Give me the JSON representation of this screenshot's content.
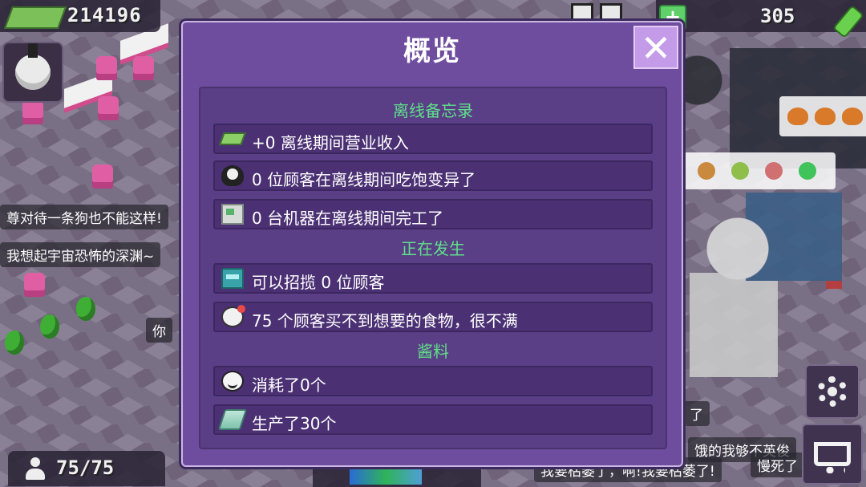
{
  "hud": {
    "money": "214196",
    "customers": "75/75",
    "energy": "305"
  },
  "background_chat": [
    "尊对待一条狗也不能这样!",
    "我想起宇宙恐怖的深渊~",
    "你",
    "饿的我够不英俊",
    "慢死了",
    "我要枯萎了，啊!我要枯萎了!",
    "了"
  ],
  "dialog": {
    "title": "概览",
    "close_label": "✕",
    "sections": [
      {
        "title": "离线备忘录",
        "rows": [
          {
            "icon": "cash-icon",
            "text": "+0 离线期间营业收入"
          },
          {
            "icon": "customer-face-icon",
            "text": "0 位顾客在离线期间吃饱变异了"
          },
          {
            "icon": "machine-icon",
            "text": "0 台机器在离线期间完工了"
          }
        ]
      },
      {
        "title": "正在发生",
        "rows": [
          {
            "icon": "door-icon",
            "text": "可以招揽 0 位顾客"
          },
          {
            "icon": "angry-customer-icon",
            "text": "75 个顾客买不到想要的食物，很不满"
          }
        ]
      },
      {
        "title": "酱料",
        "rows": [
          {
            "icon": "smile-icon",
            "text": "消耗了0个"
          },
          {
            "icon": "sauce-dispenser-icon",
            "text": "生产了30个"
          }
        ]
      }
    ]
  },
  "colors": {
    "dialog_bg": "#6e4c9e",
    "section_title": "#5fe08a",
    "close_button": "#c49be8"
  }
}
